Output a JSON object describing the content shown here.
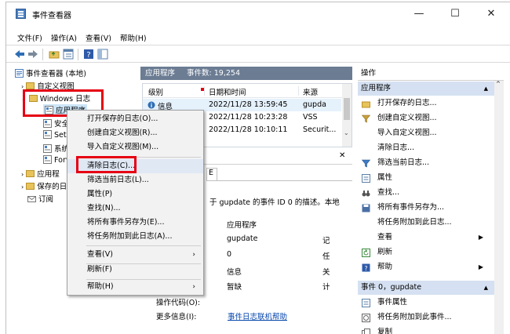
{
  "window": {
    "title": "事件查看器",
    "controls": {
      "minimize": "—",
      "maximize": "☐",
      "close": "✕"
    }
  },
  "menubar": [
    "文件(F)",
    "操作(A)",
    "查看(V)",
    "帮助(H)"
  ],
  "tree": {
    "root": "事件查看器 (本地)",
    "custom_views": "自定义视图",
    "windows_logs": "Windows 日志",
    "application": "应用程序",
    "security_partial": "安全",
    "setup_partial": "Setu",
    "system_partial": "系统",
    "forwarded_partial": "Forv",
    "apps_services_partial": "应用程",
    "saved_logs_partial": "保存的日",
    "subscriptions": "订阅"
  },
  "middle": {
    "header_title": "应用程序",
    "header_count": "事件数: 19,254",
    "columns": [
      "级别",
      "日期和时间",
      "来源"
    ],
    "rows": [
      {
        "level": "信息",
        "datetime": "2022/11/28 13:59:45",
        "source": "gupda"
      },
      {
        "level": "",
        "datetime": "2022/11/28 10:23:28",
        "source": "VSS"
      },
      {
        "level": "",
        "datetime": "2022/11/28 10:10:11",
        "source": "Securit..."
      }
    ],
    "detail_close": "✕",
    "detail_tab_partial": "E",
    "detail_desc": "于 gupdate 的事件 ID 0 的描述。本地",
    "detail_values": [
      "应用程序",
      "gupdate",
      "0",
      "信息",
      "暂缺"
    ],
    "detail_right_labels": [
      "记",
      "任",
      "关",
      "计"
    ],
    "op_code_label": "操作代码(O):",
    "more_info_label": "更多信息(I):",
    "more_info_link": "事件日志联机帮助"
  },
  "context_menu": {
    "items": [
      "打开保存的日志(O)...",
      "创建自定义视图(R)...",
      "导入自定义视图(M)...",
      "清除日志(C)...",
      "筛选当前日志(L)...",
      "属性(P)",
      "查找(N)...",
      "将所有事件另存为(E)...",
      "将任务附加到此日志(A)...",
      "查看(V)",
      "刷新(F)",
      "帮助(H)"
    ],
    "submenu_arrow": "›"
  },
  "actions": {
    "title": "操作",
    "section1": "应用程序",
    "items1": [
      "打开保存的日志...",
      "创建自定义视图...",
      "导入自定义视图...",
      "清除日志...",
      "筛选当前日志...",
      "属性",
      "查找...",
      "将所有事件另存为...",
      "将任务附加到此日志...",
      "查看",
      "刷新",
      "帮助"
    ],
    "section2": "事件 0，gupdate",
    "items2": [
      "事件属性",
      "将任务附加到此事件...",
      "复制"
    ],
    "arrow_up": "▲",
    "arrow_right": "▶"
  },
  "colors": {
    "highlight_red": "#e60012",
    "section_blue": "#d5e1f2",
    "header_gray": "#6b7c93",
    "link_blue": "#0645ad"
  }
}
